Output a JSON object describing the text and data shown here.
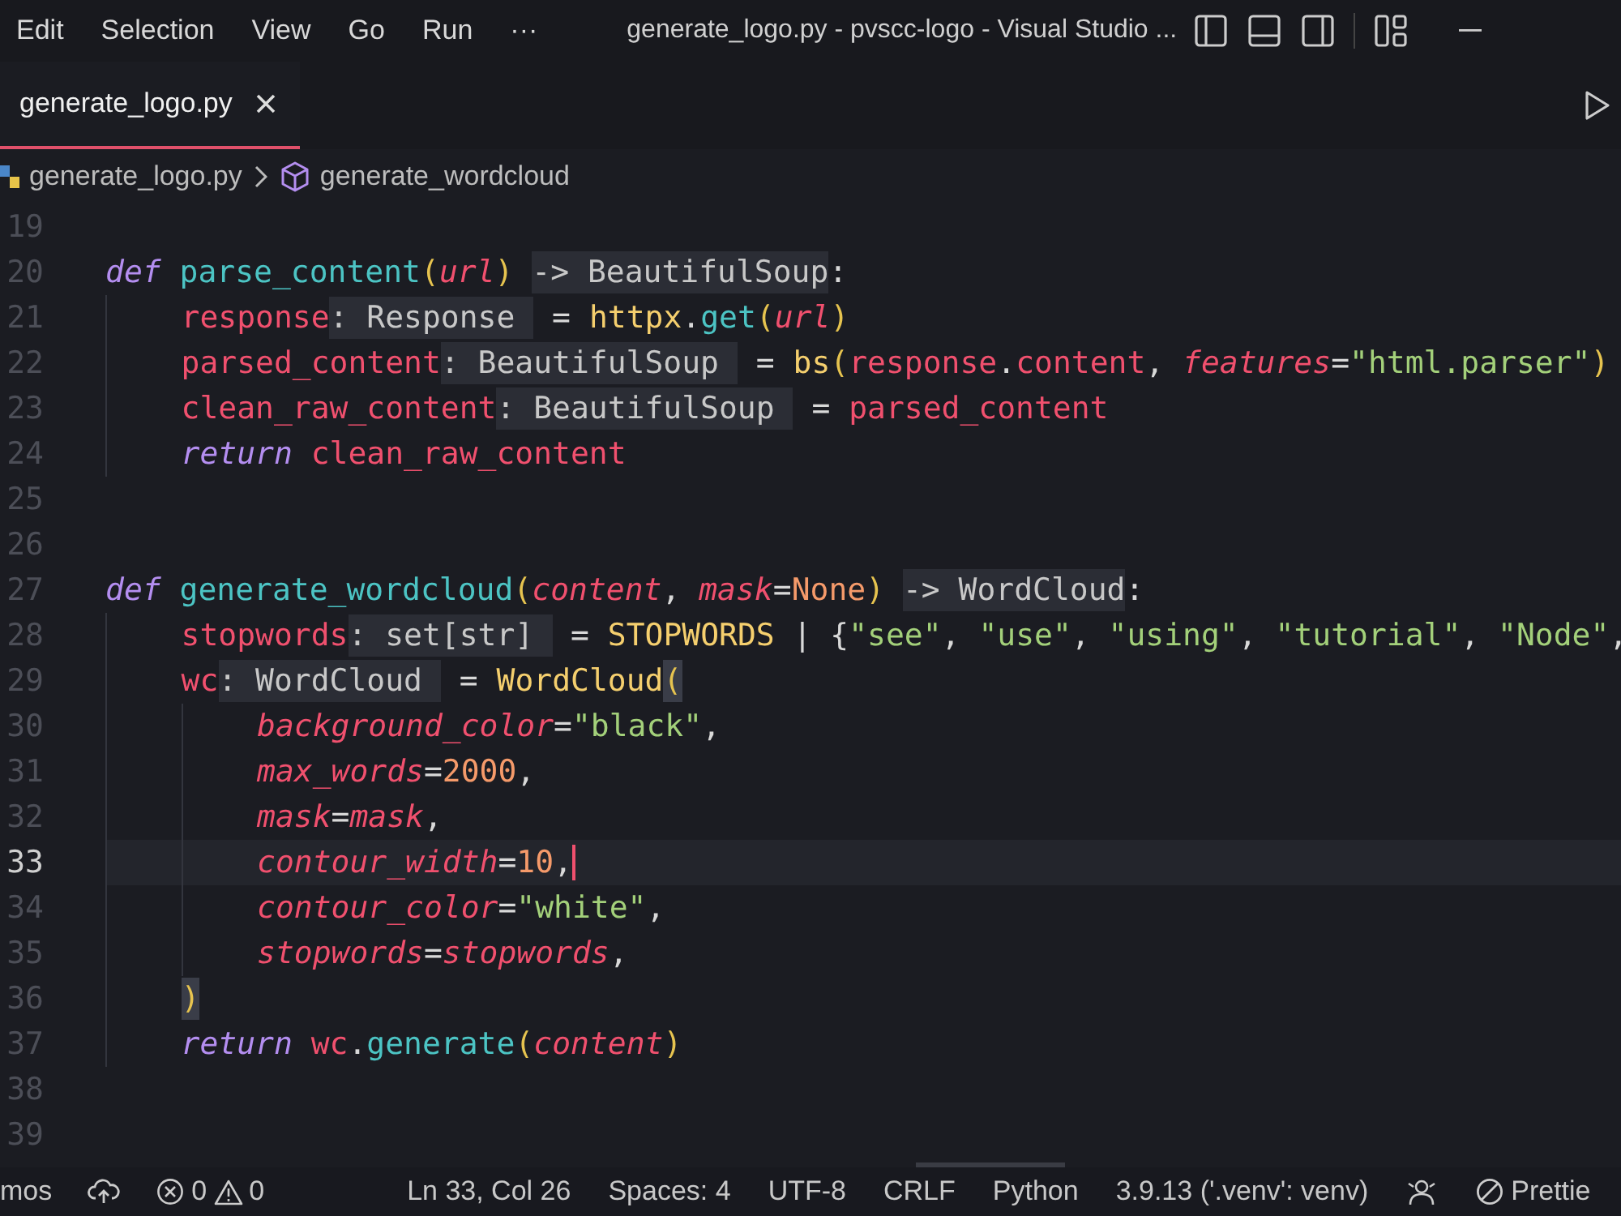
{
  "titlebar": {
    "menus": [
      "Edit",
      "Selection",
      "View",
      "Go",
      "Run",
      "···"
    ],
    "title": "generate_logo.py - pvscc-logo - Visual Studio ..."
  },
  "tabs": [
    {
      "label": "generate_logo.py",
      "selected": true
    }
  ],
  "breadcrumbs": [
    {
      "kind": "file",
      "label": "generate_logo.py"
    },
    {
      "kind": "symbol",
      "label": "generate_wordcloud"
    }
  ],
  "code": [
    {
      "number": "19",
      "current": false
    },
    {
      "number": "20",
      "current": false,
      "tokens": [
        {
          "kind": "keyword",
          "text": "def "
        },
        {
          "kind": "function",
          "text": "parse_content"
        },
        {
          "kind": "paren",
          "text": "("
        },
        {
          "kind": "param",
          "text": "url"
        },
        {
          "kind": "paren",
          "text": ") "
        },
        {
          "kind": "hint",
          "text": "-> BeautifulSoup"
        },
        {
          "kind": "plain",
          "text": ":"
        }
      ],
      "children": [
        {
          "number": "21",
          "current": false,
          "tokens": [
            {
              "kind": "variable",
              "text": "response"
            },
            {
              "kind": "hint",
              "text": ": Response "
            },
            {
              "kind": "plain",
              "text": " = "
            },
            {
              "kind": "call",
              "text": "httpx"
            },
            {
              "kind": "plain",
              "text": "."
            },
            {
              "kind": "function",
              "text": "get"
            },
            {
              "kind": "paren",
              "text": "("
            },
            {
              "kind": "param",
              "text": "url"
            },
            {
              "kind": "paren",
              "text": ")"
            }
          ]
        },
        {
          "number": "22",
          "current": false,
          "tokens": [
            {
              "kind": "variable",
              "text": "parsed_content"
            },
            {
              "kind": "hint",
              "text": ": BeautifulSoup "
            },
            {
              "kind": "plain",
              "text": " = "
            },
            {
              "kind": "call",
              "text": "bs"
            },
            {
              "kind": "paren",
              "text": "("
            },
            {
              "kind": "variable",
              "text": "response"
            },
            {
              "kind": "plain",
              "text": "."
            },
            {
              "kind": "variable",
              "text": "content"
            },
            {
              "kind": "plain",
              "text": ", "
            },
            {
              "kind": "param",
              "text": "features"
            },
            {
              "kind": "plain",
              "text": "="
            },
            {
              "kind": "string",
              "text": "\"html.parser\""
            },
            {
              "kind": "paren",
              "text": ")"
            }
          ]
        },
        {
          "number": "23",
          "current": false,
          "tokens": [
            {
              "kind": "variable",
              "text": "clean_raw_content"
            },
            {
              "kind": "hint",
              "text": ": BeautifulSoup "
            },
            {
              "kind": "plain",
              "text": " = "
            },
            {
              "kind": "variable",
              "text": "parsed_content"
            }
          ]
        },
        {
          "number": "24",
          "current": false,
          "tokens": [
            {
              "kind": "keyword",
              "text": "return "
            },
            {
              "kind": "variable",
              "text": "clean_raw_content"
            }
          ]
        }
      ]
    },
    {
      "number": "25",
      "current": false
    },
    {
      "number": "26",
      "current": false
    },
    {
      "number": "27",
      "current": false,
      "tokens": [
        {
          "kind": "keyword",
          "text": "def "
        },
        {
          "kind": "function",
          "text": "generate_wordcloud"
        },
        {
          "kind": "paren",
          "text": "("
        },
        {
          "kind": "param",
          "text": "content"
        },
        {
          "kind": "plain",
          "text": ", "
        },
        {
          "kind": "param",
          "text": "mask"
        },
        {
          "kind": "plain",
          "text": "="
        },
        {
          "kind": "number",
          "text": "None"
        },
        {
          "kind": "paren",
          "text": ") "
        },
        {
          "kind": "hint",
          "text": "-> WordCloud"
        },
        {
          "kind": "plain",
          "text": ":"
        }
      ],
      "children": [
        {
          "number": "28",
          "current": false,
          "tokens": [
            {
              "kind": "variable",
              "text": "stopwords"
            },
            {
              "kind": "hint",
              "text": ": set[str] "
            },
            {
              "kind": "plain",
              "text": " = "
            },
            {
              "kind": "call",
              "text": "STOPWORDS"
            },
            {
              "kind": "plain",
              "text": " | {"
            },
            {
              "kind": "string",
              "text": "\"see\""
            },
            {
              "kind": "plain",
              "text": ", "
            },
            {
              "kind": "string",
              "text": "\"use\""
            },
            {
              "kind": "plain",
              "text": ", "
            },
            {
              "kind": "string",
              "text": "\"using\""
            },
            {
              "kind": "plain",
              "text": ", "
            },
            {
              "kind": "string",
              "text": "\"tutorial\""
            },
            {
              "kind": "plain",
              "text": ", "
            },
            {
              "kind": "string",
              "text": "\"Node\""
            },
            {
              "kind": "plain",
              "text": ","
            }
          ]
        },
        {
          "number": "29",
          "current": false,
          "tokens": [
            {
              "kind": "variable",
              "text": "wc"
            },
            {
              "kind": "hint",
              "text": ": WordCloud "
            },
            {
              "kind": "plain",
              "text": " = "
            },
            {
              "kind": "call",
              "text": "WordCloud"
            },
            {
              "kind": "paren-match",
              "text": "("
            }
          ],
          "children": [
            {
              "number": "30",
              "current": false,
              "tokens": [
                {
                  "kind": "param",
                  "text": "background_color"
                },
                {
                  "kind": "plain",
                  "text": "="
                },
                {
                  "kind": "string",
                  "text": "\"black\""
                },
                {
                  "kind": "plain",
                  "text": ","
                }
              ]
            },
            {
              "number": "31",
              "current": false,
              "tokens": [
                {
                  "kind": "param",
                  "text": "max_words"
                },
                {
                  "kind": "plain",
                  "text": "="
                },
                {
                  "kind": "number",
                  "text": "2000"
                },
                {
                  "kind": "plain",
                  "text": ","
                }
              ]
            },
            {
              "number": "32",
              "current": false,
              "tokens": [
                {
                  "kind": "param",
                  "text": "mask"
                },
                {
                  "kind": "plain",
                  "text": "="
                },
                {
                  "kind": "param",
                  "text": "mask"
                },
                {
                  "kind": "plain",
                  "text": ","
                }
              ]
            },
            {
              "number": "33",
              "current": true,
              "tokens": [
                {
                  "kind": "param",
                  "text": "contour_width"
                },
                {
                  "kind": "plain",
                  "text": "="
                },
                {
                  "kind": "number",
                  "text": "10"
                },
                {
                  "kind": "plain",
                  "text": ","
                }
              ]
            },
            {
              "number": "34",
              "current": false,
              "tokens": [
                {
                  "kind": "param",
                  "text": "contour_color"
                },
                {
                  "kind": "plain",
                  "text": "="
                },
                {
                  "kind": "string",
                  "text": "\"white\""
                },
                {
                  "kind": "plain",
                  "text": ","
                }
              ]
            },
            {
              "number": "35",
              "current": false,
              "tokens": [
                {
                  "kind": "param",
                  "text": "stopwords"
                },
                {
                  "kind": "plain",
                  "text": "="
                },
                {
                  "kind": "param",
                  "text": "stopwords"
                },
                {
                  "kind": "plain",
                  "text": ","
                }
              ]
            }
          ]
        },
        {
          "number": "36",
          "current": false,
          "tokens": [
            {
              "kind": "paren-match",
              "text": ")"
            }
          ]
        },
        {
          "number": "37",
          "current": false,
          "tokens": [
            {
              "kind": "keyword",
              "text": "return "
            },
            {
              "kind": "variable",
              "text": "wc"
            },
            {
              "kind": "plain",
              "text": "."
            },
            {
              "kind": "function",
              "text": "generate"
            },
            {
              "kind": "paren",
              "text": "("
            },
            {
              "kind": "param",
              "text": "content"
            },
            {
              "kind": "paren",
              "text": ")"
            }
          ]
        }
      ]
    },
    {
      "number": "38",
      "current": false
    },
    {
      "number": "39",
      "current": false
    }
  ],
  "status_bar": {
    "left": [
      {
        "kind": "text",
        "text": "mos"
      },
      {
        "kind": "sync"
      },
      {
        "kind": "problems",
        "errors": "0",
        "warnings": "0"
      }
    ],
    "right": [
      {
        "kind": "text",
        "text": "Ln 33, Col 26"
      },
      {
        "kind": "text",
        "text": "Spaces: 4"
      },
      {
        "kind": "text",
        "text": "UTF-8"
      },
      {
        "kind": "text",
        "text": "CRLF"
      },
      {
        "kind": "text",
        "text": "Python"
      },
      {
        "kind": "text",
        "text": "3.9.13 ('.venv': venv)"
      },
      {
        "kind": "feedback"
      },
      {
        "kind": "formatter",
        "text": "Prettie"
      }
    ]
  }
}
